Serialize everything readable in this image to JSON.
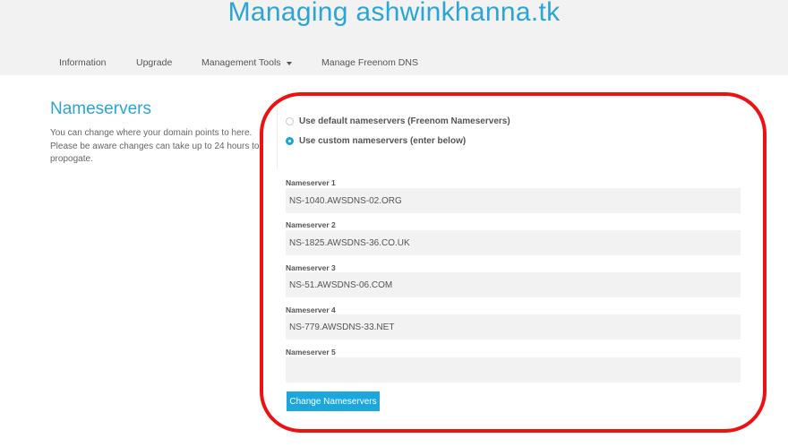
{
  "header": {
    "title": "Managing ashwinkhanna.tk"
  },
  "nav": {
    "items": [
      {
        "label": "Information"
      },
      {
        "label": "Upgrade"
      },
      {
        "label": "Management Tools",
        "icon": "caret-down-icon"
      },
      {
        "label": "Manage Freenom DNS"
      }
    ]
  },
  "section": {
    "heading": "Nameservers",
    "description": "You can change where your domain points to here. Please be aware changes can take up to 24 hours to propogate."
  },
  "options": {
    "default_label": "Use default nameservers (Freenom Nameservers)",
    "custom_label": "Use custom nameservers (enter below)",
    "selected": "custom"
  },
  "nameservers": [
    {
      "label": "Nameserver 1",
      "value": "NS-1040.AWSDNS-02.ORG"
    },
    {
      "label": "Nameserver 2",
      "value": "NS-1825.AWSDNS-36.CO.UK"
    },
    {
      "label": "Nameserver 3",
      "value": "NS-51.AWSDNS-06.COM"
    },
    {
      "label": "Nameserver 4",
      "value": "NS-779.AWSDNS-33.NET"
    },
    {
      "label": "Nameserver 5",
      "value": ""
    }
  ],
  "actions": {
    "submit_label": "Change Nameservers"
  },
  "colors": {
    "accent": "#2ba5d6",
    "button": "#1ba6dd",
    "highlight": "#ee1111",
    "field_bg": "#f2f2f2",
    "header_bg": "#f2f2f2"
  }
}
